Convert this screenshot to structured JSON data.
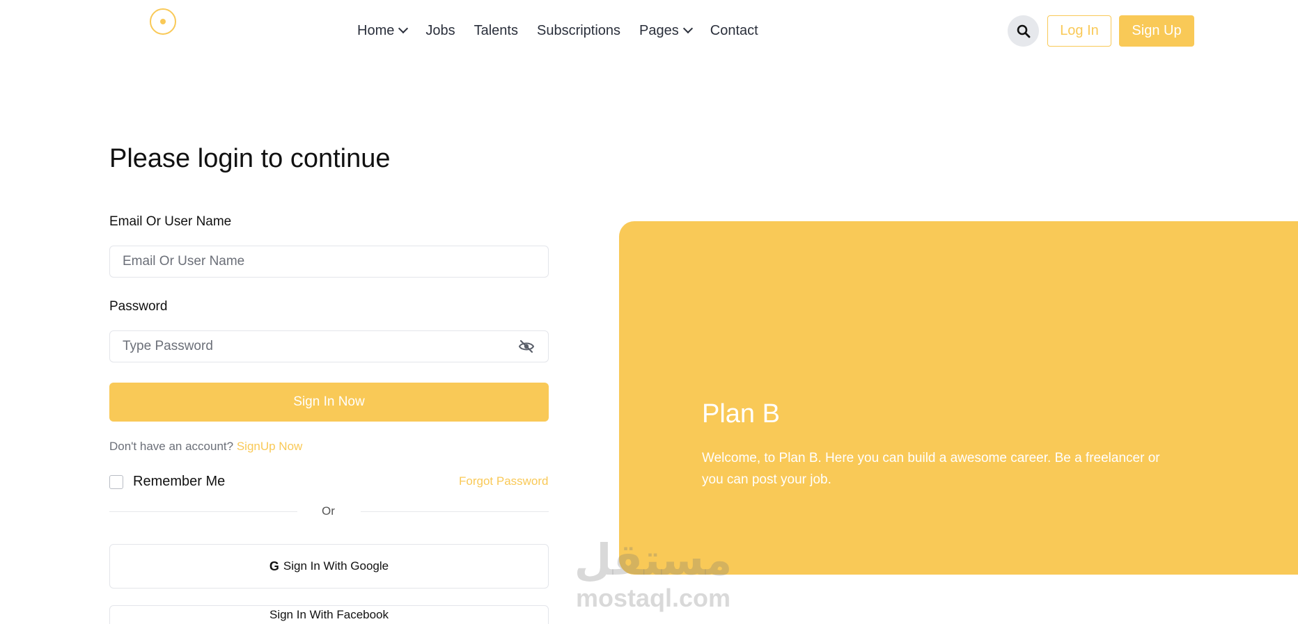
{
  "nav": {
    "items": [
      {
        "label": "Home",
        "dropdown": true
      },
      {
        "label": "Jobs",
        "dropdown": false
      },
      {
        "label": "Talents",
        "dropdown": false
      },
      {
        "label": "Subscriptions",
        "dropdown": false
      },
      {
        "label": "Pages",
        "dropdown": true
      },
      {
        "label": "Contact",
        "dropdown": false
      }
    ],
    "login_label": "Log In",
    "signup_label": "Sign Up"
  },
  "form": {
    "title": "Please login to continue",
    "email_label": "Email Or User Name",
    "email_placeholder": "Email Or User Name",
    "password_label": "Password",
    "password_placeholder": "Type Password",
    "submit_label": "Sign In Now",
    "no_account_text": "Don't have an account?",
    "signup_link": "SignUp Now",
    "remember_label": "Remember Me",
    "forgot_label": "Forgot Password",
    "or_text": "Or",
    "google_label": "Sign In With Google",
    "google_icon_glyph": "G",
    "facebook_label": "Sign In With Facebook"
  },
  "promo": {
    "title": "Plan B",
    "text": "Welcome, to Plan B. Here you can build a awesome career. Be a freelancer or you can post your job."
  },
  "watermark": {
    "arabic": "مستقل",
    "latin": "mostaql.com"
  },
  "colors": {
    "accent": "#f9c957",
    "text": "#111111",
    "muted": "#6b6f78"
  }
}
